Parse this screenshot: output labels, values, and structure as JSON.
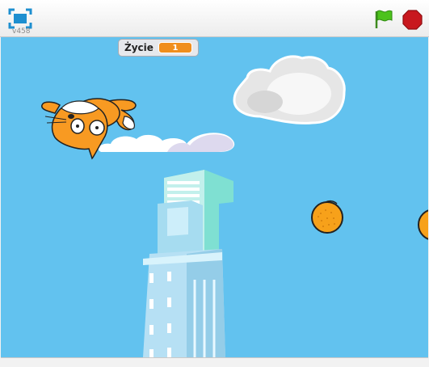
{
  "player": {
    "version": "v458",
    "controls": {
      "fullscreen_icon": "fullscreen-icon",
      "green_flag_icon": "green-flag-icon",
      "stop_icon": "stop-sign-icon"
    }
  },
  "stage": {
    "background_color": "#62c2ef",
    "monitor": {
      "label": "Życie",
      "value": "1",
      "value_color": "#f08e1d"
    },
    "sprites": [
      "cat-sprite",
      "cloud-small",
      "cloud-large",
      "skyscraper",
      "orange",
      "orange-partial"
    ]
  }
}
